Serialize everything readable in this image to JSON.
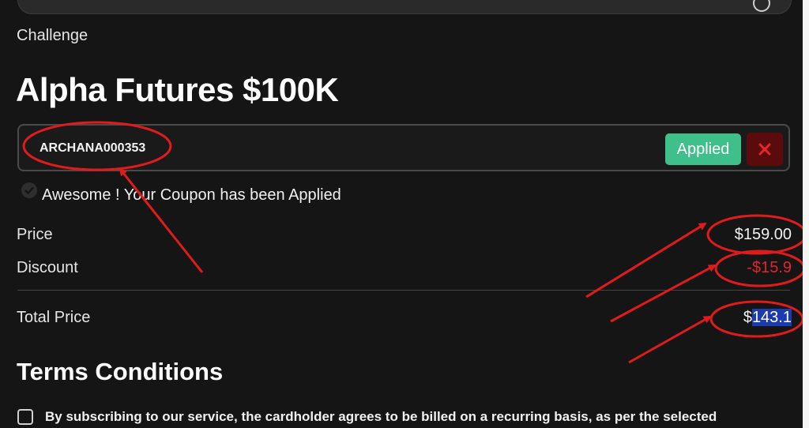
{
  "product": {
    "category_label": "Challenge",
    "title": "Alpha Futures $100K"
  },
  "coupon": {
    "code": "ARCHANA000353",
    "applied_label": "Applied",
    "remove_icon": "close-icon",
    "success_message": "Awesome ! Your Coupon has been Applied",
    "success_icon": "check-circle-icon"
  },
  "summary": {
    "price_label": "Price",
    "price_value": "$159.00",
    "discount_label": "Discount",
    "discount_value": "-$15.9",
    "total_label": "Total Price",
    "total_currency": "$",
    "total_amount": "143.1"
  },
  "terms": {
    "title": "Terms Conditions",
    "checkbox_text": "By subscribing to our service, the cardholder agrees to be billed on a recurring basis, as per the selected"
  },
  "colors": {
    "background": "#151515",
    "applied_green": "#3fbf8a",
    "remove_red": "#5a0b0b",
    "discount_red": "#e0262b",
    "annotation_red": "#e01b1b",
    "selection_blue": "#1d3bb0"
  }
}
